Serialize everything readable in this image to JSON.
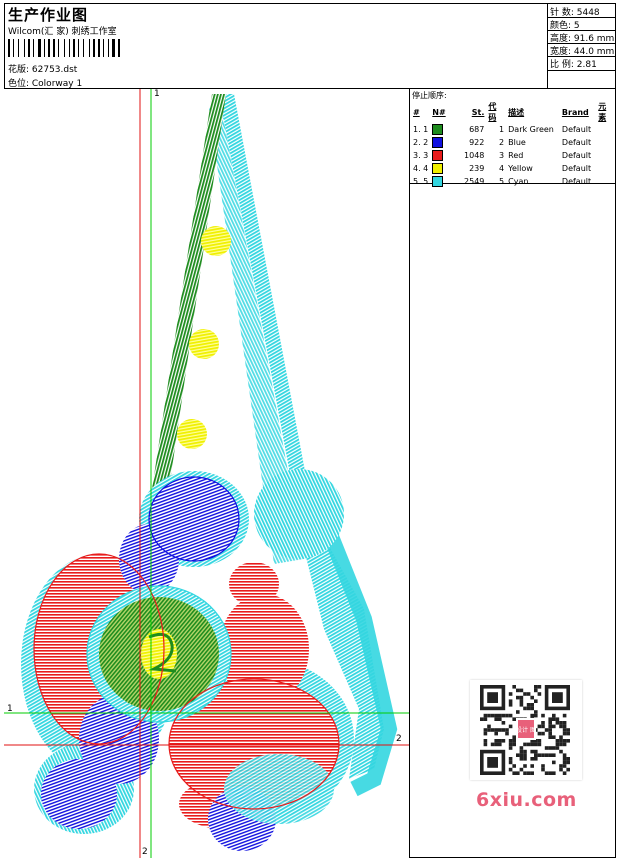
{
  "header": {
    "title": "生产作业图",
    "company": "Wilcom(汇 家) 刺绣工作室",
    "design_file": "花版: 62753.dst",
    "colorway": "色位: Colorway 1"
  },
  "stats": {
    "stitches": "针 数: 5448",
    "colors": "颜色: 5",
    "height": "高度: 91.6 mm",
    "width": "宽度: 44.0 mm",
    "scale": "比 例: 2.81"
  },
  "stop_sequence": {
    "title": "停止顺序:",
    "headers": [
      "#",
      "N#",
      "St.",
      "代码",
      "描述",
      "Brand",
      "元素"
    ],
    "rows": [
      {
        "index": "1. 1",
        "swatch": "#1e8c1e",
        "stitches": "687",
        "code": "1",
        "description": "Dark Green",
        "brand": "Default"
      },
      {
        "index": "2. 2",
        "swatch": "#1010e0",
        "stitches": "922",
        "code": "2",
        "description": "Blue",
        "brand": "Default"
      },
      {
        "index": "3. 3",
        "swatch": "#e81c1c",
        "stitches": "1048",
        "code": "3",
        "description": "Red",
        "brand": "Default"
      },
      {
        "index": "4. 4",
        "swatch": "#f0f000",
        "stitches": "239",
        "code": "4",
        "description": "Yellow",
        "brand": "Default"
      },
      {
        "index": "5. 5",
        "swatch": "#33d6e0",
        "stitches": "2549",
        "code": "5",
        "description": "Cyan",
        "brand": "Default"
      }
    ]
  },
  "axes": {
    "green_top": "1",
    "green_left": "1",
    "red_right": "2",
    "red_bottom": "2"
  },
  "watermark": {
    "text": "6xiu.com",
    "qr_center": "设计 图"
  }
}
